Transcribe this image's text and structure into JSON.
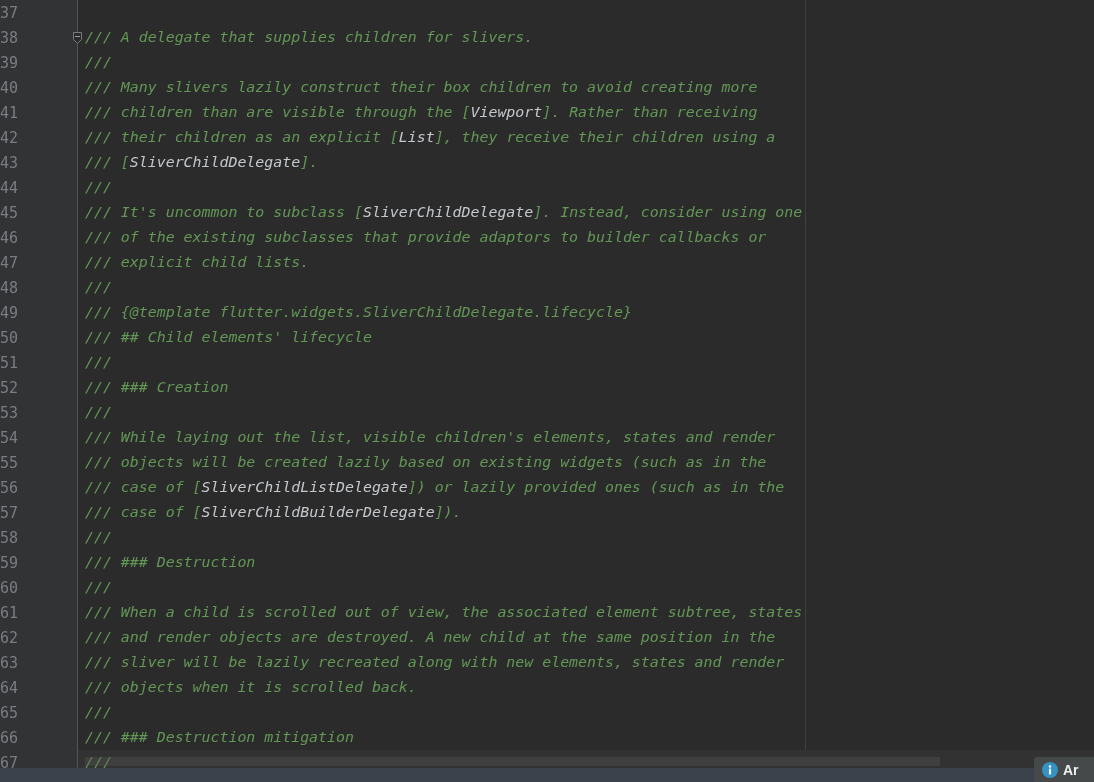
{
  "editor": {
    "lines": [
      {
        "number": "37",
        "fold_marker": false,
        "current": false
      },
      {
        "number": "38",
        "fold_marker": true,
        "current": false,
        "segments": [
          {
            "kind": "comment",
            "text": "/// A delegate that supplies children for slivers."
          }
        ]
      },
      {
        "number": "39",
        "fold_marker": false,
        "current": false,
        "segments": [
          {
            "kind": "comment",
            "text": "///"
          }
        ]
      },
      {
        "number": "40",
        "fold_marker": false,
        "current": false,
        "segments": [
          {
            "kind": "comment",
            "text": "/// Many slivers lazily construct their box children to avoid creating more"
          }
        ]
      },
      {
        "number": "41",
        "fold_marker": false,
        "current": false,
        "segments": [
          {
            "kind": "comment",
            "text": "/// children than are visible through the ["
          },
          {
            "kind": "reference",
            "text": "Viewport"
          },
          {
            "kind": "comment",
            "text": "]. Rather than receiving"
          }
        ]
      },
      {
        "number": "42",
        "fold_marker": false,
        "current": false,
        "segments": [
          {
            "kind": "comment",
            "text": "/// their children as an explicit ["
          },
          {
            "kind": "reference",
            "text": "List"
          },
          {
            "kind": "comment",
            "text": "], they receive their children using a"
          }
        ]
      },
      {
        "number": "43",
        "fold_marker": false,
        "current": false,
        "segments": [
          {
            "kind": "comment",
            "text": "/// ["
          },
          {
            "kind": "reference",
            "text": "SliverChildDelegate"
          },
          {
            "kind": "comment",
            "text": "]."
          }
        ]
      },
      {
        "number": "44",
        "fold_marker": false,
        "current": false,
        "segments": [
          {
            "kind": "comment",
            "text": "///"
          }
        ]
      },
      {
        "number": "45",
        "fold_marker": false,
        "current": false,
        "segments": [
          {
            "kind": "comment",
            "text": "/// It's uncommon to subclass ["
          },
          {
            "kind": "reference",
            "text": "SliverChildDelegate"
          },
          {
            "kind": "comment",
            "text": "]. Instead, consider using one"
          }
        ]
      },
      {
        "number": "46",
        "fold_marker": false,
        "current": false,
        "segments": [
          {
            "kind": "comment",
            "text": "/// of the existing subclasses that provide adaptors to builder callbacks or"
          }
        ]
      },
      {
        "number": "47",
        "fold_marker": false,
        "current": false,
        "segments": [
          {
            "kind": "comment",
            "text": "/// explicit child lists."
          }
        ]
      },
      {
        "number": "48",
        "fold_marker": false,
        "current": false,
        "segments": [
          {
            "kind": "comment",
            "text": "///"
          }
        ]
      },
      {
        "number": "49",
        "fold_marker": false,
        "current": false,
        "segments": [
          {
            "kind": "comment",
            "text": "/// {@template flutter.widgets.SliverChildDelegate.lifecycle}"
          }
        ]
      },
      {
        "number": "50",
        "fold_marker": false,
        "current": false,
        "segments": [
          {
            "kind": "comment",
            "text": "/// ## Child elements' lifecycle"
          }
        ]
      },
      {
        "number": "51",
        "fold_marker": false,
        "current": false,
        "segments": [
          {
            "kind": "comment",
            "text": "///"
          }
        ]
      },
      {
        "number": "52",
        "fold_marker": false,
        "current": false,
        "segments": [
          {
            "kind": "comment",
            "text": "/// ### Creation"
          }
        ]
      },
      {
        "number": "53",
        "fold_marker": false,
        "current": false,
        "segments": [
          {
            "kind": "comment",
            "text": "///"
          }
        ]
      },
      {
        "number": "54",
        "fold_marker": false,
        "current": false,
        "segments": [
          {
            "kind": "comment",
            "text": "/// While laying out the list, visible children's elements, states and render"
          }
        ]
      },
      {
        "number": "55",
        "fold_marker": false,
        "current": false,
        "segments": [
          {
            "kind": "comment",
            "text": "/// objects will be created lazily based on existing widgets (such as in the"
          }
        ]
      },
      {
        "number": "56",
        "fold_marker": false,
        "current": false,
        "segments": [
          {
            "kind": "comment",
            "text": "/// case of ["
          },
          {
            "kind": "reference",
            "text": "SliverChildListDelegate"
          },
          {
            "kind": "comment",
            "text": "]) or lazily provided ones (such as in the"
          }
        ]
      },
      {
        "number": "57",
        "fold_marker": false,
        "current": false,
        "segments": [
          {
            "kind": "comment",
            "text": "/// case of ["
          },
          {
            "kind": "reference",
            "text": "SliverChildBuilderDelegate"
          },
          {
            "kind": "comment",
            "text": "])."
          }
        ]
      },
      {
        "number": "58",
        "fold_marker": false,
        "current": false,
        "segments": [
          {
            "kind": "comment",
            "text": "///"
          }
        ]
      },
      {
        "number": "59",
        "fold_marker": false,
        "current": false,
        "segments": [
          {
            "kind": "comment",
            "text": "/// ### Destruction"
          }
        ]
      },
      {
        "number": "60",
        "fold_marker": false,
        "current": false,
        "segments": [
          {
            "kind": "comment",
            "text": "///"
          }
        ]
      },
      {
        "number": "61",
        "fold_marker": false,
        "current": false,
        "segments": [
          {
            "kind": "comment",
            "text": "/// When a child is scrolled out of view, the associated element subtree, states"
          }
        ]
      },
      {
        "number": "62",
        "fold_marker": false,
        "current": false,
        "segments": [
          {
            "kind": "comment",
            "text": "/// and render objects are destroyed. A new child at the same position in the"
          }
        ]
      },
      {
        "number": "63",
        "fold_marker": false,
        "current": false,
        "segments": [
          {
            "kind": "comment",
            "text": "/// sliver will be lazily recreated along with new elements, states and render"
          }
        ]
      },
      {
        "number": "64",
        "fold_marker": false,
        "current": false,
        "segments": [
          {
            "kind": "comment",
            "text": "/// objects when it is scrolled back."
          }
        ]
      },
      {
        "number": "65",
        "fold_marker": false,
        "current": false,
        "segments": [
          {
            "kind": "comment",
            "text": "///"
          }
        ]
      },
      {
        "number": "66",
        "fold_marker": false,
        "current": false,
        "segments": [
          {
            "kind": "comment",
            "text": "/// ### Destruction mitigation"
          }
        ]
      },
      {
        "number": "67",
        "fold_marker": false,
        "current": true,
        "segments": [
          {
            "kind": "comment",
            "text": "///"
          }
        ]
      }
    ]
  },
  "notification": {
    "text": "Ar"
  }
}
